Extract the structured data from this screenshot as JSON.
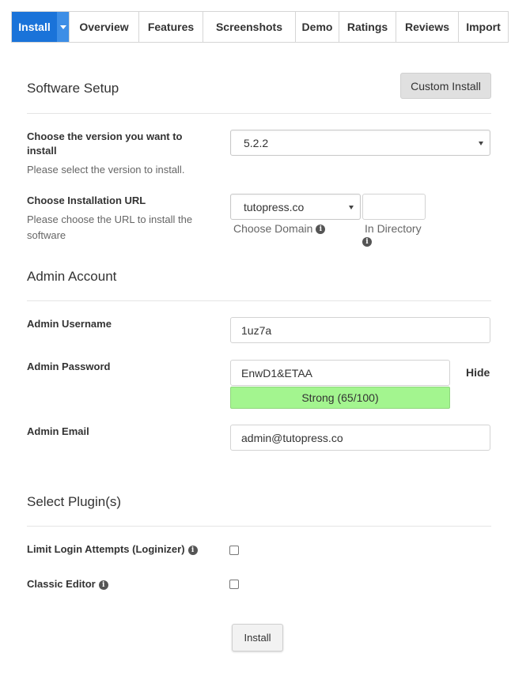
{
  "tabs": [
    {
      "label": "Install"
    },
    {
      "label": "Overview"
    },
    {
      "label": "Features"
    },
    {
      "label": "Screenshots"
    },
    {
      "label": "Demo"
    },
    {
      "label": "Ratings"
    },
    {
      "label": "Reviews"
    },
    {
      "label": "Import"
    }
  ],
  "software_setup": {
    "title": "Software Setup",
    "custom_install_label": "Custom Install",
    "version": {
      "label_line1": "Choose the version you want to",
      "label_line2": "install",
      "help": "Please select the version to install.",
      "selected": "5.2.2"
    },
    "url": {
      "label": "Choose Installation URL",
      "help_line1": "Please choose the URL to install the",
      "help_line2": "software",
      "domain_selected": "tutopress.co",
      "directory_value": "",
      "domain_help": "Choose Domain",
      "directory_help": "In Directory"
    }
  },
  "admin_account": {
    "title": "Admin Account",
    "username_label": "Admin Username",
    "username_value": "1uz7a",
    "password_label": "Admin Password",
    "password_value": "EnwD1&ETAA",
    "hide_label": "Hide",
    "strength_text": "Strong (65/100)",
    "strength_score": 65,
    "email_label": "Admin Email",
    "email_value": "admin@tutopress.co"
  },
  "plugins": {
    "title": "Select Plugin(s)",
    "items": [
      {
        "label": "Limit Login Attempts (Loginizer)",
        "checked": false
      },
      {
        "label": "Classic Editor",
        "checked": false
      }
    ]
  },
  "install_button_label": "Install",
  "colors": {
    "active_tab": "#1a73d9",
    "strength_bar": "#a3f58f"
  }
}
